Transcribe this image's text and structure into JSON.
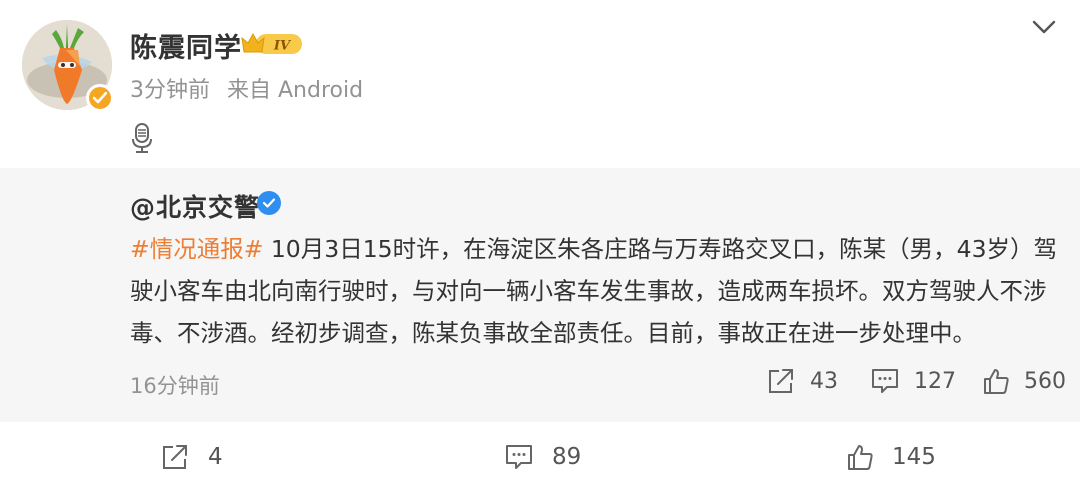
{
  "post": {
    "username": "陈震同学",
    "rank_badge": "IV",
    "time": "3分钟前",
    "source": "来自 Android",
    "icons": {
      "avatar": "avatar-carrot-illustration",
      "verified": "orange-verified-badge-icon",
      "rank": "crown-rank-badge-icon",
      "menu": "chevron-down-icon",
      "voice": "microphone-icon"
    }
  },
  "repost": {
    "author": "@北京交警",
    "hashtag": "#情况通报#",
    "text": " 10月3日15时许，在海淀区朱各庄路与万寿路交叉口，陈某（男，43岁）驾驶小客车由北向南行驶时，与对向一辆小客车发生事故，造成两车损坏。双方驾驶人不涉毒、不涉酒。经初步调查，陈某负事故全部责任。目前，事故正在进一步处理中。",
    "time": "16分钟前",
    "stats": {
      "reposts": "43",
      "comments": "127",
      "likes": "560"
    }
  },
  "actions": {
    "repost": "4",
    "comment": "89",
    "like": "145"
  },
  "colors": {
    "hashtag": "#ec7e34",
    "verified_blue": "#2e8ff0",
    "verified_orange": "#f6a623",
    "muted": "#939393",
    "repost_bg": "#f6f6f6"
  }
}
